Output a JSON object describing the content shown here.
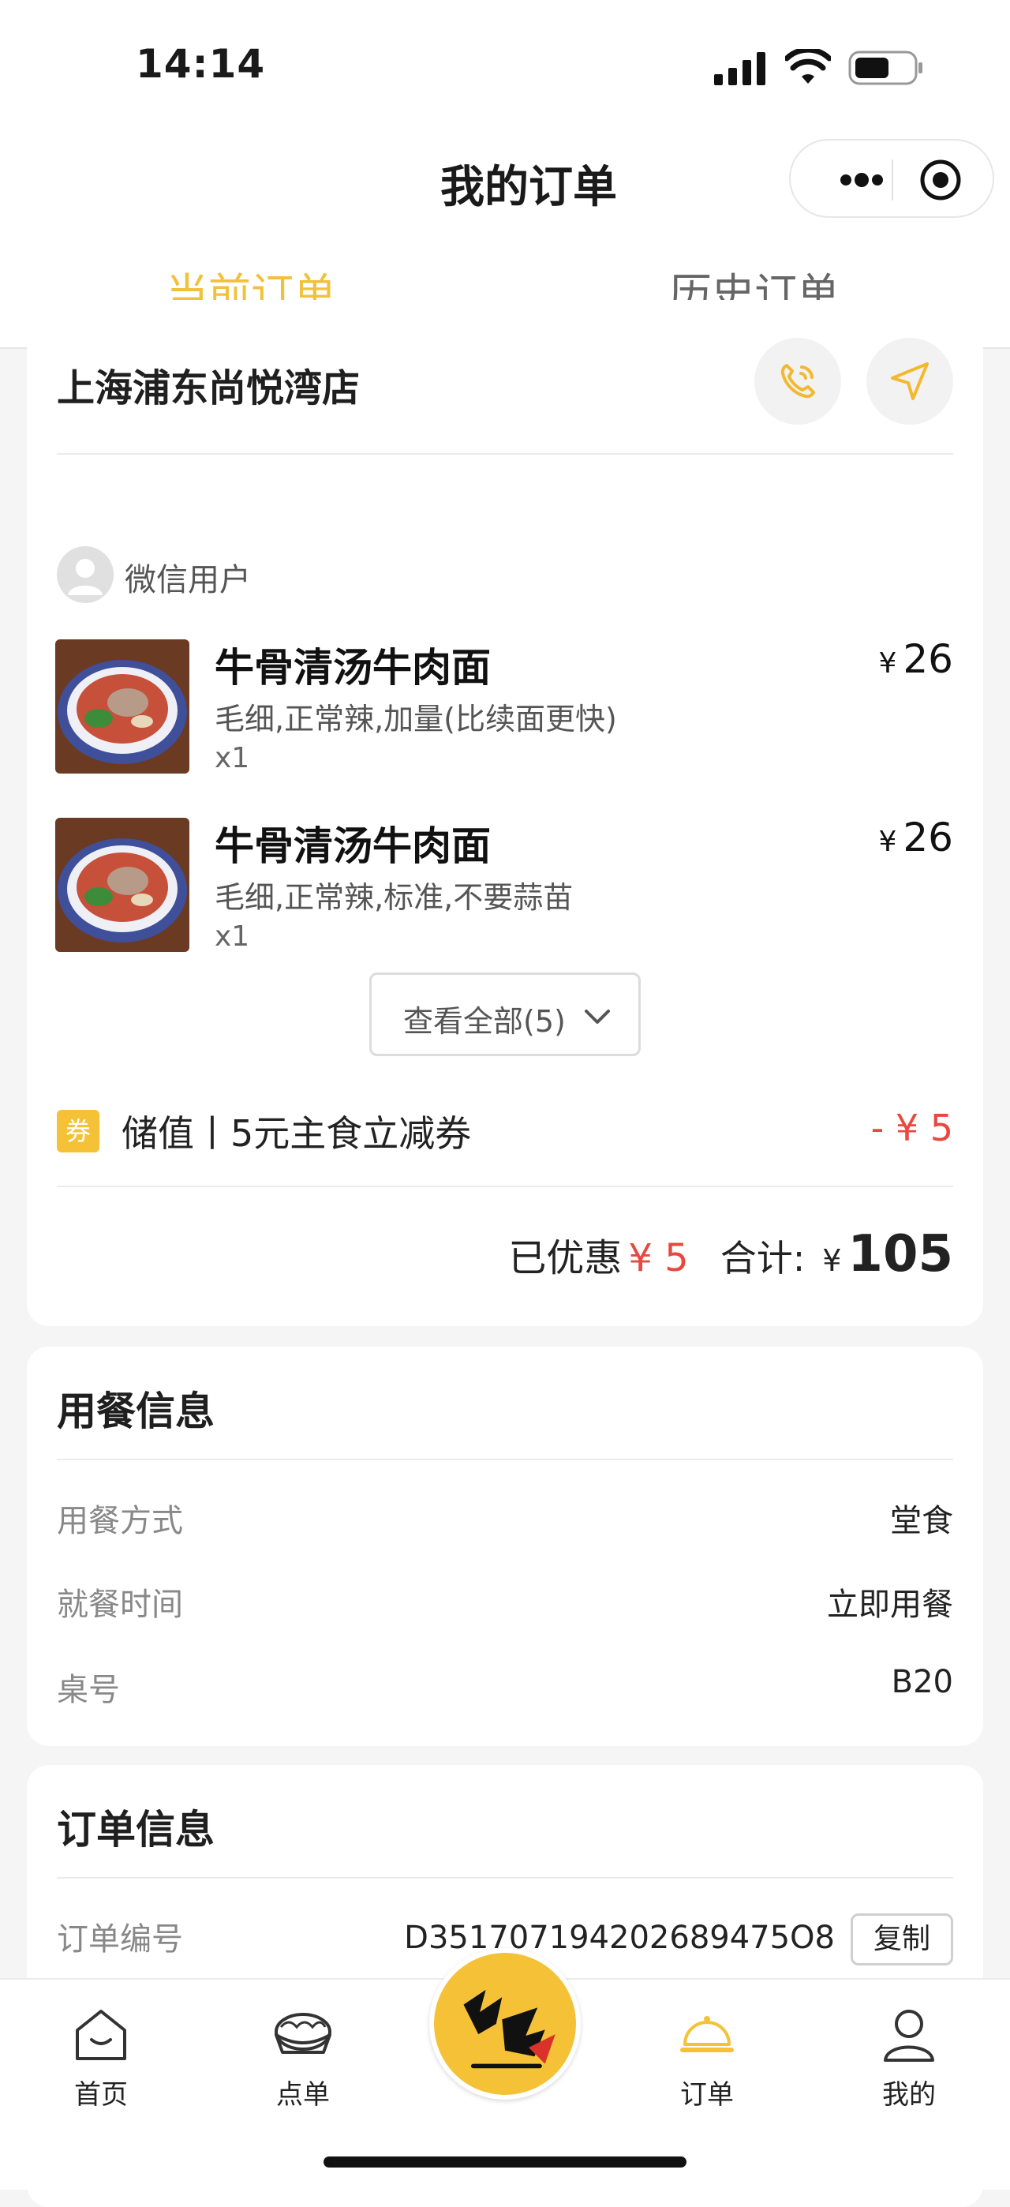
{
  "status_bar": {
    "time": "14:14"
  },
  "header": {
    "title": "我的订单"
  },
  "tabs": {
    "current": "当前订单",
    "history": "历史订单"
  },
  "order": {
    "store_name": "上海浦东尚悦湾店",
    "user_name": "微信用户",
    "currency": "¥",
    "items": [
      {
        "name": "牛骨清汤牛肉面",
        "spec": "毛细,正常辣,加量(比续面更快)",
        "qty": "x1",
        "price": "26"
      },
      {
        "name": "牛骨清汤牛肉面",
        "spec": "毛细,正常辣,标准,不要蒜苗",
        "qty": "x1",
        "price": "26"
      }
    ],
    "view_all_label": "查看全部(5)",
    "coupon": {
      "badge": "券",
      "text": "储值丨5元主食立减券",
      "amount": "- ¥ 5"
    },
    "saved_label": "已优惠",
    "saved_value": "¥ 5",
    "total_label": "合计:",
    "total_value": "105"
  },
  "dining": {
    "title": "用餐信息",
    "rows": [
      {
        "label": "用餐方式",
        "value": "堂食"
      },
      {
        "label": "就餐时间",
        "value": "立即用餐"
      },
      {
        "label": "桌号",
        "value": "B20"
      }
    ]
  },
  "order_info": {
    "title": "订单信息",
    "order_no_label": "订单编号",
    "order_no_value": "D351707194202689475O8",
    "copy_label": "复制"
  },
  "tabbar": {
    "items": [
      {
        "label": "首页",
        "icon": "home-icon"
      },
      {
        "label": "点单",
        "icon": "noodle-bowl-icon"
      },
      {
        "label": "订单",
        "icon": "cloche-icon"
      },
      {
        "label": "我的",
        "icon": "user-icon"
      }
    ]
  },
  "colors": {
    "accent": "#f5c237",
    "discount_red": "#e8483f"
  }
}
